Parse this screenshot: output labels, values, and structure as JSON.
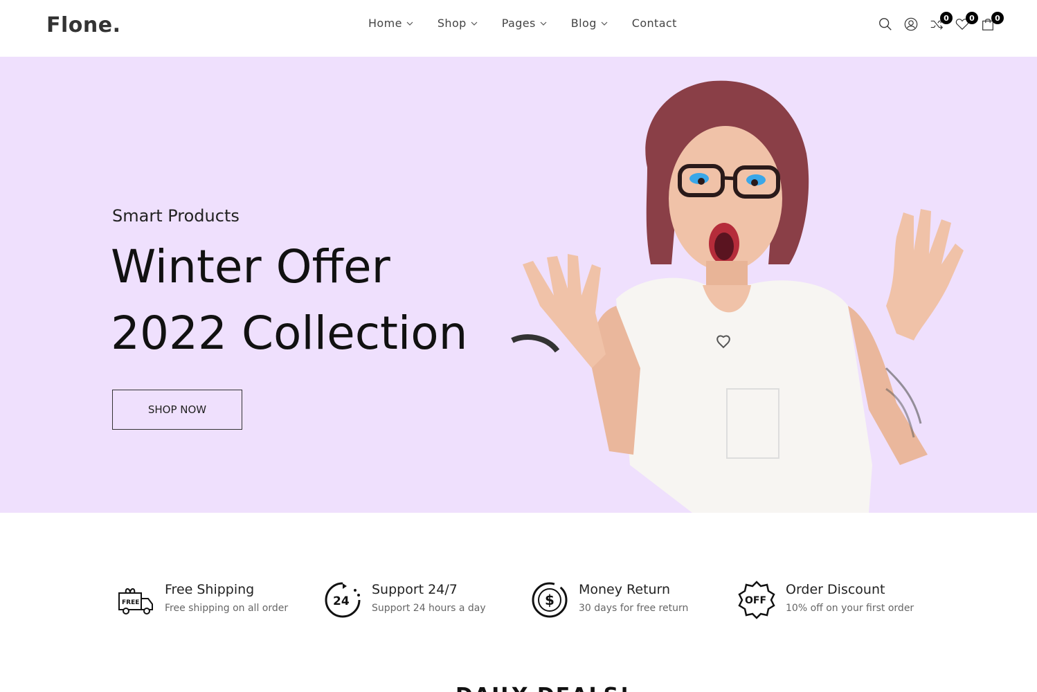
{
  "header": {
    "logo": "Flone.",
    "nav": [
      {
        "label": "Home",
        "has_dropdown": true
      },
      {
        "label": "Shop",
        "has_dropdown": true
      },
      {
        "label": "Pages",
        "has_dropdown": true
      },
      {
        "label": "Blog",
        "has_dropdown": true
      },
      {
        "label": "Contact",
        "has_dropdown": false
      }
    ],
    "icons": {
      "search": "search-icon",
      "account": "user-icon",
      "compare": "shuffle-icon",
      "wishlist": "heart-icon",
      "cart": "bag-icon"
    },
    "counts": {
      "compare": "0",
      "wishlist": "0",
      "cart": "0"
    }
  },
  "hero": {
    "subtitle": "Smart Products",
    "title_line1": "Winter Offer",
    "title_line2": "2022 Collection",
    "button": "SHOP NOW",
    "background": "#efe0fd"
  },
  "features": [
    {
      "icon": "free-truck-icon",
      "title": "Free Shipping",
      "desc": "Free shipping on all order"
    },
    {
      "icon": "support-24-icon",
      "title": "Support 24/7",
      "desc": "Support 24 hours a day"
    },
    {
      "icon": "money-return-icon",
      "title": "Money Return",
      "desc": "30 days for free return"
    },
    {
      "icon": "discount-icon",
      "title": "Order Discount",
      "desc": "10% off on your first order"
    }
  ],
  "section": {
    "heading": "DAILY DEALS!"
  }
}
